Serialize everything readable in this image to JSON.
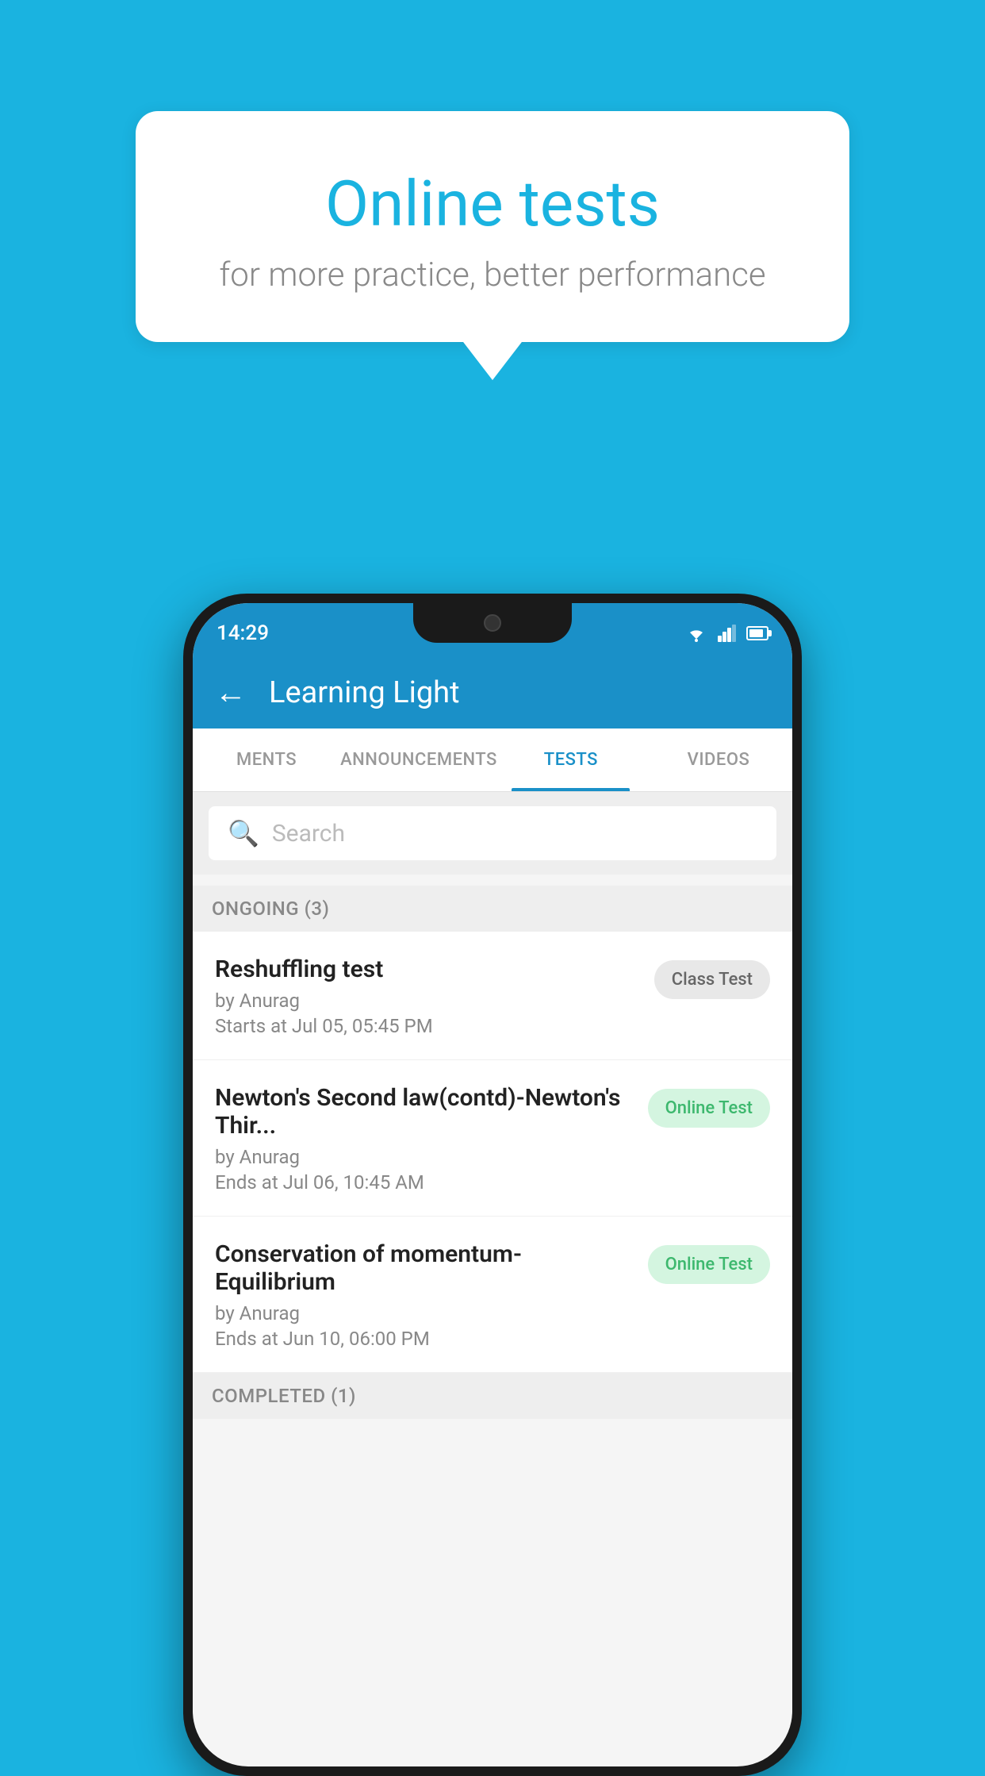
{
  "background_color": "#1ab3e0",
  "speech_bubble": {
    "title": "Online tests",
    "subtitle": "for more practice, better performance"
  },
  "status_bar": {
    "time": "14:29"
  },
  "app_header": {
    "title": "Learning Light",
    "back_label": "←"
  },
  "tabs": [
    {
      "label": "MENTS",
      "active": false
    },
    {
      "label": "ANNOUNCEMENTS",
      "active": false
    },
    {
      "label": "TESTS",
      "active": true
    },
    {
      "label": "VIDEOS",
      "active": false
    }
  ],
  "search": {
    "placeholder": "Search"
  },
  "ongoing_section": {
    "label": "ONGOING (3)"
  },
  "tests": [
    {
      "name": "Reshuffling test",
      "by": "by Anurag",
      "date": "Starts at  Jul 05, 05:45 PM",
      "badge": "Class Test",
      "badge_type": "class"
    },
    {
      "name": "Newton's Second law(contd)-Newton's Thir...",
      "by": "by Anurag",
      "date": "Ends at  Jul 06, 10:45 AM",
      "badge": "Online Test",
      "badge_type": "online"
    },
    {
      "name": "Conservation of momentum-Equilibrium",
      "by": "by Anurag",
      "date": "Ends at  Jun 10, 06:00 PM",
      "badge": "Online Test",
      "badge_type": "online"
    }
  ],
  "completed_section": {
    "label": "COMPLETED (1)"
  }
}
